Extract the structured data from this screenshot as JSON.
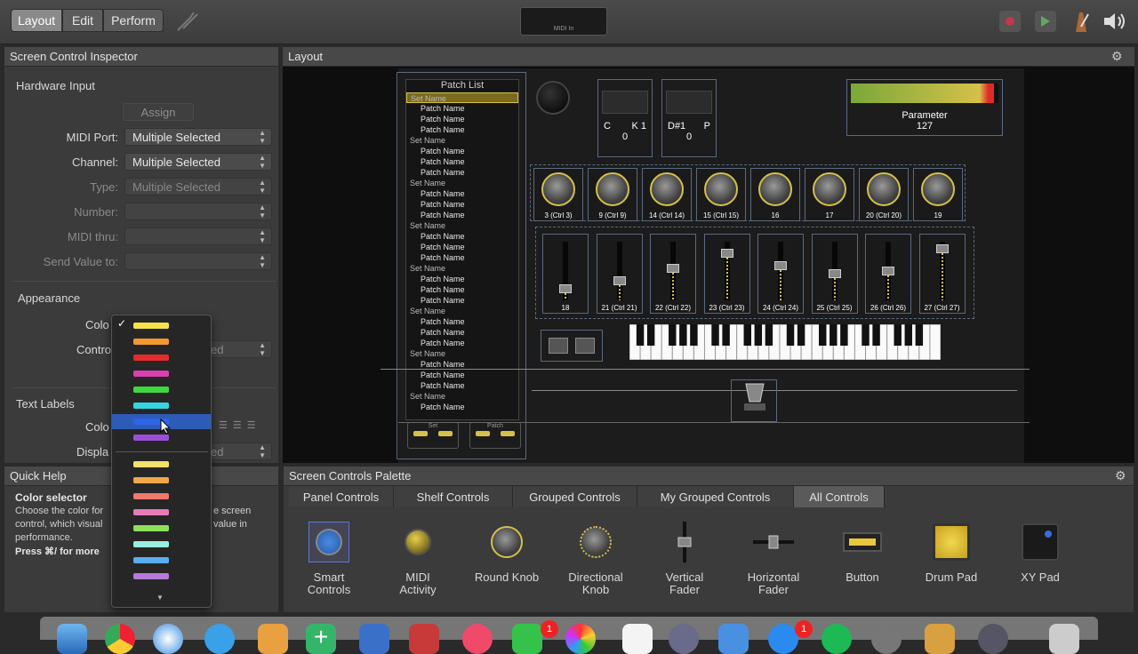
{
  "toolbar": {
    "modes": [
      "Layout",
      "Edit",
      "Perform"
    ],
    "active_mode": "Layout",
    "lcd_label": "MIDI In"
  },
  "inspector": {
    "title": "Screen Control Inspector",
    "hardware_input": {
      "heading": "Hardware Input",
      "assign_label": "Assign",
      "fields": [
        {
          "label": "MIDI Port:",
          "value": "Multiple Selected",
          "enabled": true
        },
        {
          "label": "Channel:",
          "value": "Multiple Selected",
          "enabled": true
        },
        {
          "label": "Type:",
          "value": "Multiple Selected",
          "enabled": false
        },
        {
          "label": "Number:",
          "value": "",
          "enabled": false
        },
        {
          "label": "MIDI thru:",
          "value": "",
          "enabled": false
        },
        {
          "label": "Send Value to:",
          "value": "",
          "enabled": false
        }
      ]
    },
    "appearance": {
      "heading": "Appearance",
      "color_label": "Colo",
      "control_label": "Contro",
      "control_value_tail": "ed"
    },
    "text_labels": {
      "heading": "Text Labels",
      "color_label": "Colo",
      "display_label": "Displa",
      "display_value_tail": "ed"
    }
  },
  "color_dropdown": {
    "checkmark": "✓",
    "selected_index": 6,
    "colors": [
      "#f6e24a",
      "#f29a2e",
      "#e52b2b",
      "#d83fb0",
      "#3fd83f",
      "#33d6e0",
      "#2f63e8",
      "#9b4fd6",
      "#f4e06a",
      "#f2a84a",
      "#f07a6a",
      "#e87ab8",
      "#8ee05a",
      "#9aeede",
      "#5aaef0",
      "#b47ad8"
    ],
    "scroll_arrow": "▼"
  },
  "quick_help": {
    "title": "Quick Help",
    "heading": "Color selector",
    "line1_a": "Choose the color for",
    "line1_b": "e screen",
    "line2_a": "control, which visual",
    "line2_b": "value in",
    "line3": "performance.",
    "line4": "Press ⌘/ for more"
  },
  "layout": {
    "title": "Layout",
    "patch_list": {
      "title": "Patch List",
      "rows": [
        {
          "text": "Set Name",
          "type": "set"
        },
        {
          "text": "Patch Name",
          "type": "patch"
        },
        {
          "text": "Patch Name",
          "type": "patch"
        },
        {
          "text": "Patch Name",
          "type": "patch"
        },
        {
          "text": "Set Name",
          "type": "set"
        },
        {
          "text": "Patch Name",
          "type": "patch"
        },
        {
          "text": "Patch Name",
          "type": "patch"
        },
        {
          "text": "Patch Name",
          "type": "patch"
        },
        {
          "text": "Set Name",
          "type": "set"
        },
        {
          "text": "Patch Name",
          "type": "patch"
        },
        {
          "text": "Patch Name",
          "type": "patch"
        },
        {
          "text": "Patch Name",
          "type": "patch"
        },
        {
          "text": "Set Name",
          "type": "set"
        },
        {
          "text": "Patch Name",
          "type": "patch"
        },
        {
          "text": "Patch Name",
          "type": "patch"
        },
        {
          "text": "Patch Name",
          "type": "patch"
        },
        {
          "text": "Set Name",
          "type": "set"
        },
        {
          "text": "Patch Name",
          "type": "patch"
        },
        {
          "text": "Patch Name",
          "type": "patch"
        },
        {
          "text": "Patch Name",
          "type": "patch"
        },
        {
          "text": "Set Name",
          "type": "set"
        },
        {
          "text": "Patch Name",
          "type": "patch"
        },
        {
          "text": "Patch Name",
          "type": "patch"
        },
        {
          "text": "Patch Name",
          "type": "patch"
        },
        {
          "text": "Set Name",
          "type": "set"
        },
        {
          "text": "Patch Name",
          "type": "patch"
        },
        {
          "text": "Patch Name",
          "type": "patch"
        },
        {
          "text": "Patch Name",
          "type": "patch"
        },
        {
          "text": "Set Name",
          "type": "set"
        },
        {
          "text": "Patch Name",
          "type": "patch"
        }
      ],
      "footer_set": "Set",
      "footer_patch": "Patch"
    },
    "display1": {
      "label_left": "C",
      "label_right": "K 1",
      "value": "0"
    },
    "display2": {
      "label_left": "D#1",
      "label_right": "P",
      "value": "0"
    },
    "parameter": {
      "label": "Parameter",
      "value": "127",
      "level": 0.97
    },
    "knobs": [
      "3 (Ctrl 3)",
      "9 (Ctrl 9)",
      "14 (Ctrl 14)",
      "15 (Ctrl 15)",
      "16",
      "17",
      "20 (Ctrl 20)",
      "19"
    ],
    "faders": [
      {
        "label": "18",
        "level": 0.15
      },
      {
        "label": "21 (Ctrl 21)",
        "level": 0.3
      },
      {
        "label": "22 (Ctrl 22)",
        "level": 0.55
      },
      {
        "label": "23 (Ctrl 23)",
        "level": 0.85
      },
      {
        "label": "24 (Ctrl 24)",
        "level": 0.6
      },
      {
        "label": "25 (Ctrl 25)",
        "level": 0.45
      },
      {
        "label": "26 (Ctrl 26)",
        "level": 0.5
      },
      {
        "label": "27 (Ctrl 27)",
        "level": 0.95
      }
    ]
  },
  "palette": {
    "title": "Screen Controls Palette",
    "tabs": [
      "Panel Controls",
      "Shelf Controls",
      "Grouped Controls",
      "My Grouped Controls",
      "All Controls"
    ],
    "active_tab": "All Controls",
    "items": [
      {
        "line1": "Smart",
        "line2": "Controls"
      },
      {
        "line1": "MIDI",
        "line2": "Activity"
      },
      {
        "line1": "Round Knob",
        "line2": ""
      },
      {
        "line1": "Directional",
        "line2": "Knob"
      },
      {
        "line1": "Vertical",
        "line2": "Fader"
      },
      {
        "line1": "Horizontal",
        "line2": "Fader"
      },
      {
        "line1": "Button",
        "line2": ""
      },
      {
        "line1": "Drum Pad",
        "line2": ""
      },
      {
        "line1": "XY Pad",
        "line2": ""
      }
    ]
  },
  "dock": {
    "badge_count_1": "1",
    "badge_count_2": "1"
  }
}
